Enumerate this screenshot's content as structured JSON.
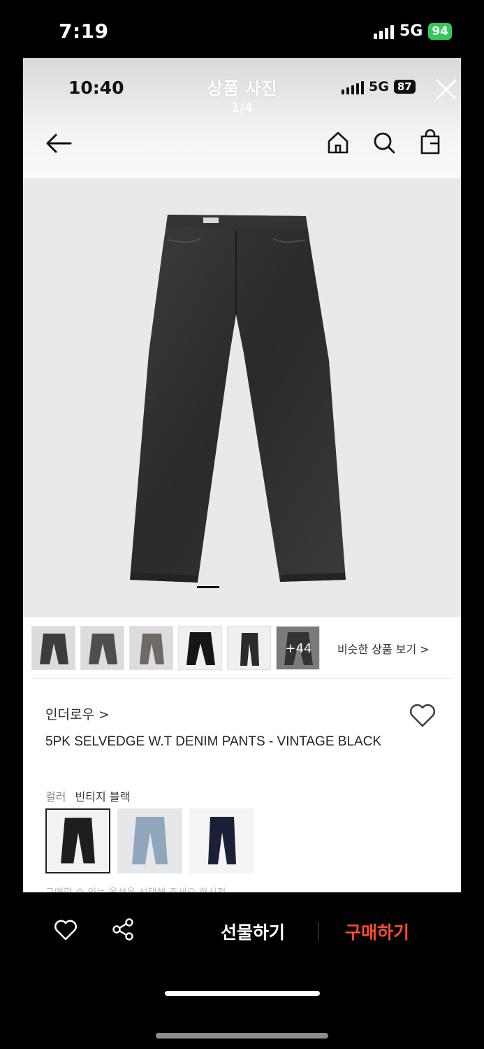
{
  "outer_status": {
    "time": "7:19",
    "network": "5G",
    "battery": "94"
  },
  "viewer": {
    "inner_time": "10:40",
    "title": "상품 사진",
    "counter": "1/4",
    "inner_network": "5G",
    "inner_battery": "87"
  },
  "thumbnails": {
    "more_label": "+44",
    "similar_label": "비슷한 상품 보기 >"
  },
  "product": {
    "brand": "인더로우 >",
    "name": "5PK SELVEDGE W.T DENIM PANTS - VINTAGE BLACK",
    "color_label": "컬러",
    "color_value": "빈티지 블랙",
    "cutoff_text": "구매할 수 있는 옵션을 선택해 주세요 한시적"
  },
  "bottom_bar": {
    "gift_label": "선물하기",
    "buy_label": "구매하기"
  },
  "colors": {
    "buy": "#ff4b2b",
    "battery_green": "#34c759"
  }
}
